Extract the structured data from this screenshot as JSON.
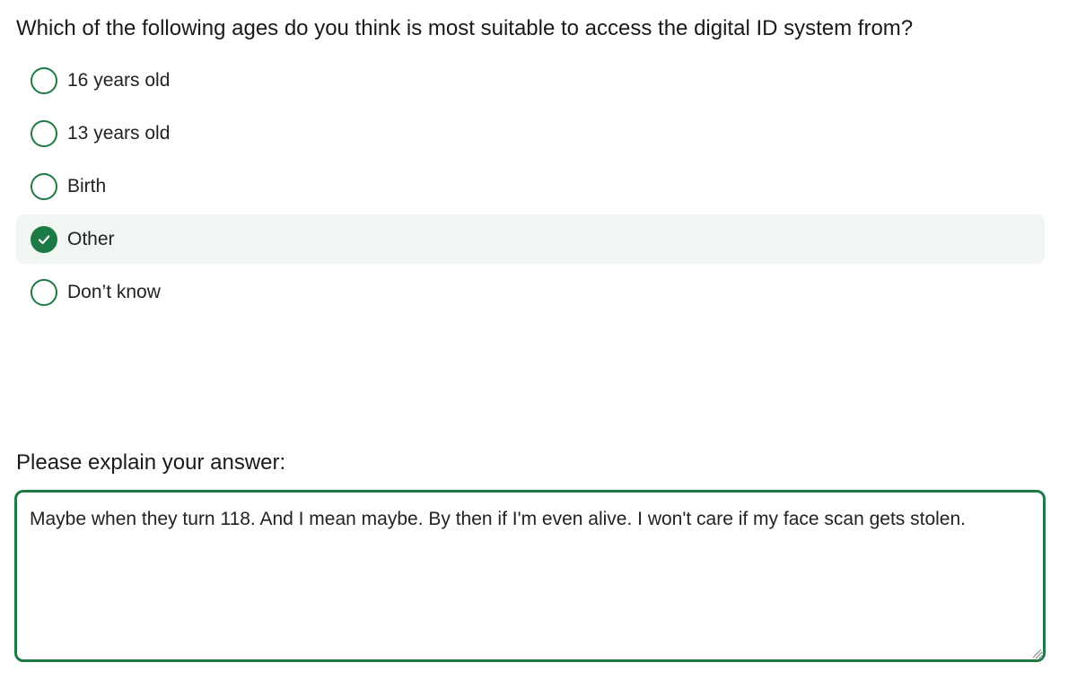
{
  "question": {
    "title": "Which of the following ages do you think is most suitable to access the digital ID system from?"
  },
  "options": [
    {
      "label": "16 years old",
      "selected": false
    },
    {
      "label": "13 years old",
      "selected": false
    },
    {
      "label": "Birth",
      "selected": false
    },
    {
      "label": "Other",
      "selected": true
    },
    {
      "label": "Don’t know",
      "selected": false
    }
  ],
  "explain": {
    "label": "Please explain your answer:",
    "value": "Maybe when they turn 118. And I mean maybe. By then if I'm even alive. I won't care if my face scan gets stolen."
  },
  "colors": {
    "accent": "#1e7a45",
    "selected_background": "#f1f6f3"
  },
  "icons": {
    "radio_selected": "checkmark-icon",
    "textarea_resize": "resize-grip-icon"
  }
}
